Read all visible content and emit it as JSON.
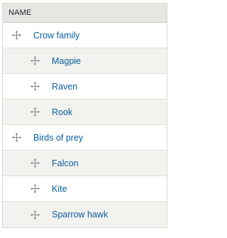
{
  "table": {
    "header": "NAME",
    "rows": [
      {
        "label": "Crow family",
        "depth": 0
      },
      {
        "label": "Magpie",
        "depth": 1
      },
      {
        "label": "Raven",
        "depth": 1
      },
      {
        "label": "Rook",
        "depth": 1
      },
      {
        "label": "Birds of prey",
        "depth": 0
      },
      {
        "label": "Falcon",
        "depth": 1
      },
      {
        "label": "Kite",
        "depth": 1
      },
      {
        "label": "Sparrow hawk",
        "depth": 1
      }
    ]
  },
  "icons": {
    "drag_handle": "move-arrows-icon"
  },
  "colors": {
    "header_bg": "#e6e6e2",
    "link": "#0a5fa0",
    "alt_row": "#f2f2ee",
    "handle": "#8a8a8a"
  }
}
